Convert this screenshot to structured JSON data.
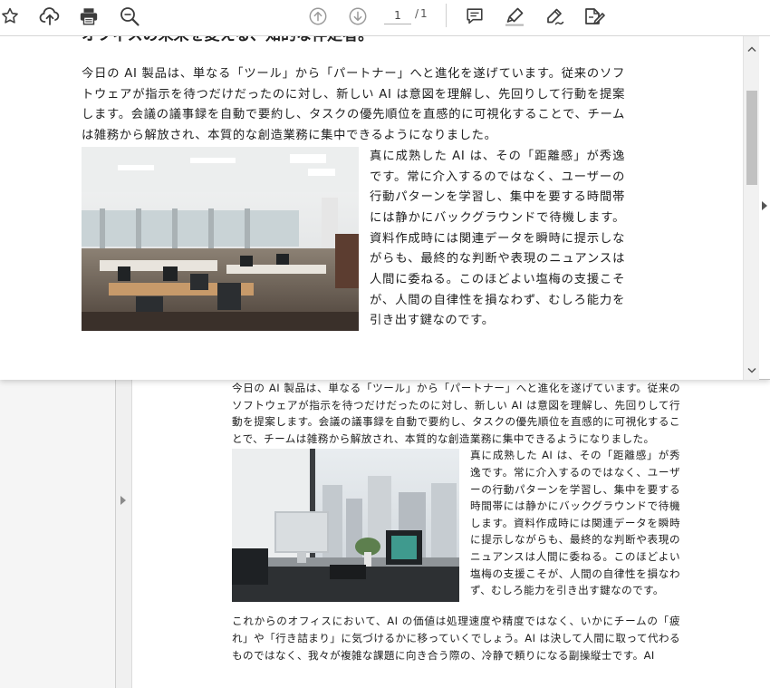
{
  "toolbar": {
    "page_current": "1",
    "page_separator": "/",
    "page_total": "1"
  },
  "document": {
    "heading": "オフィスの未来を変える、知的な伴走者。",
    "para1": "今日の AI 製品は、単なる「ツール」から「パートナー」へと進化を遂げています。従来のソフトウェアが指示を待つだけだったのに対し、新しい AI は意図を理解し、先回りして行動を提案します。会議の議事録を自動で要約し、タスクの優先順位を直感的に可視化することで、チームは雑務から解放され、本質的な創造業務に集中できるようになりました。",
    "para2": "真に成熟した AI は、その「距離感」が秀逸です。常に介入するのではなく、ユーザーの行動パターンを学習し、集中を要する時間帯には静かにバックグラウンドで待機します。資料作成時には関連データを瞬時に提示しながらも、最終的な判断や表現のニュアンスは人間に委ねる。このほどよい塩梅の支援こそが、人間の自律性を損なわず、むしろ能力を引き出す鍵なのです。",
    "para3": "これからのオフィスにおいて、AI の価値は処理速度や精度ではなく、いかにチームの「疲れ」や「行き詰まり」に気づけるかに移っていくでしょう。AI は決して人間に取って代わるものではなく、我々が複雑な課題に向き合う際の、冷静で頼りになる副操縦士です。AI"
  },
  "icons": {
    "bookmark": "star-icon",
    "upload": "cloud-upload-icon",
    "print": "printer-icon",
    "search": "search-icon",
    "prev": "arrow-up-circle-icon",
    "next": "arrow-down-circle-icon",
    "comment": "comment-icon",
    "highlight": "highlighter-icon",
    "draw": "pen-icon",
    "sign": "signature-icon"
  },
  "colors": {
    "icon": "#3c3c3c",
    "icon_disabled": "#9a9a9a"
  }
}
